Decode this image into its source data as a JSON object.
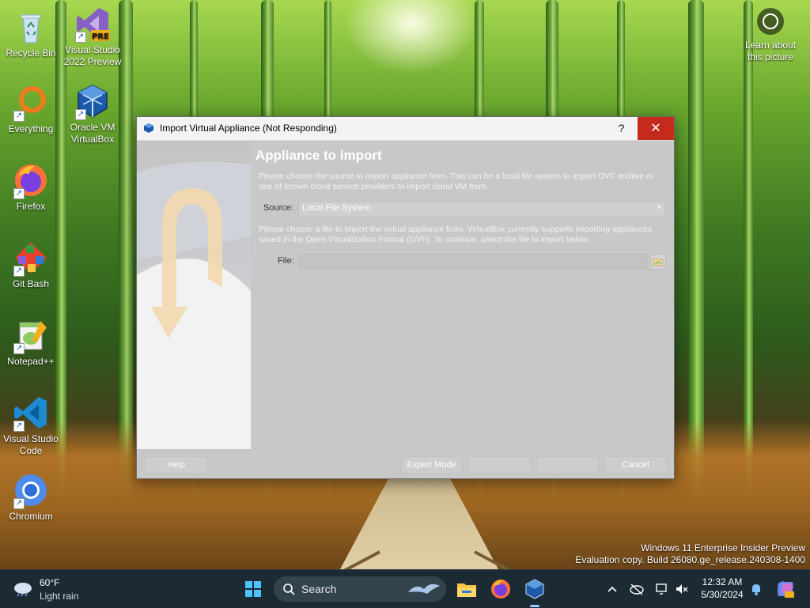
{
  "desktop": {
    "icons": [
      {
        "label_line1": "Recycle Bin",
        "label_line2": "",
        "icon": "recycle-bin-icon"
      },
      {
        "label_line1": "Visual Studio",
        "label_line2": "2022 Preview",
        "icon": "visual-studio-preview-icon",
        "badge": "PRE"
      },
      {
        "label_line1": "Everything",
        "label_line2": "",
        "icon": "everything-search-icon"
      },
      {
        "label_line1": "Oracle VM",
        "label_line2": "VirtualBox",
        "icon": "virtualbox-icon"
      },
      {
        "label_line1": "Firefox",
        "label_line2": "",
        "icon": "firefox-icon"
      },
      {
        "label_line1": "Git Bash",
        "label_line2": "",
        "icon": "git-bash-icon"
      },
      {
        "label_line1": "Notepad++",
        "label_line2": "",
        "icon": "notepad-plus-plus-icon"
      },
      {
        "label_line1": "Visual Studio",
        "label_line2": "Code",
        "icon": "vscode-icon"
      },
      {
        "label_line1": "Chromium",
        "label_line2": "",
        "icon": "chromium-icon"
      }
    ],
    "learn": {
      "line1": "Learn about",
      "line2": "this picture"
    },
    "watermark": {
      "line1": "Windows 11 Enterprise Insider Preview",
      "line2": "Evaluation copy. Build 26080.ge_release.240308-1400"
    }
  },
  "dialog": {
    "title": "Import Virtual Appliance (Not Responding)",
    "help_glyph": "?",
    "close_glyph": "✕",
    "heading": "Appliance to import",
    "intro": "Please choose the source to import appliance from. This can be a local file system to import OVF archive or one of known cloud service providers to import cloud VM from.",
    "source_label": "Source:",
    "source_value": "Local File System",
    "file_intro": "Please choose a file to import the virtual appliance from. VirtualBox currently supports importing appliances saved in the Open Virtualization Format (OVF). To continue, select the file to import below.",
    "file_label": "File:",
    "file_value": "",
    "buttons": {
      "help": "Help",
      "expert": "Expert Mode",
      "back": "",
      "next": "",
      "cancel": "Cancel"
    }
  },
  "taskbar": {
    "weather": {
      "temp": "60°F",
      "condition": "Light rain"
    },
    "search_label": "Search",
    "clock": {
      "time": "12:32 AM",
      "date": "5/30/2024"
    }
  }
}
